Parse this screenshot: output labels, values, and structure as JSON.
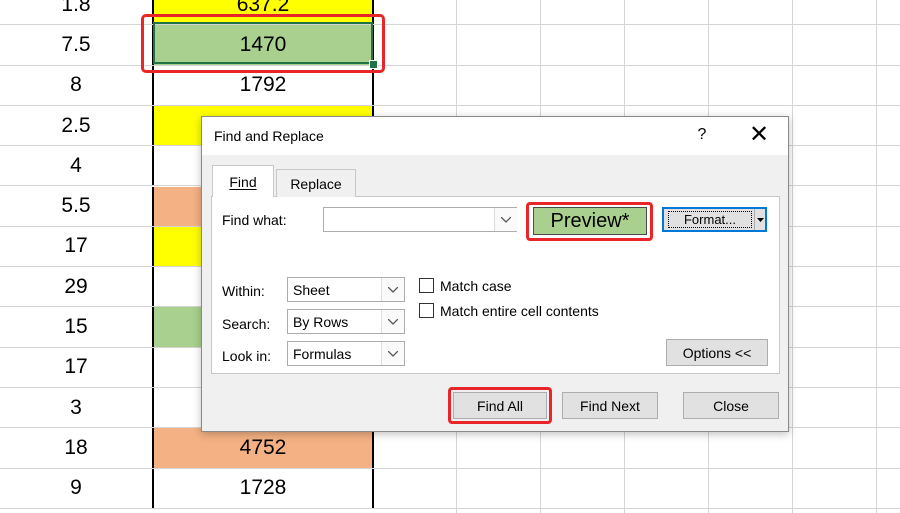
{
  "spreadsheet": {
    "rows": [
      {
        "a": "1.8",
        "b": "637.2",
        "fill": "#ffff00"
      },
      {
        "a": "7.5",
        "b": "1470",
        "fill": "#a9d08e"
      },
      {
        "a": "8",
        "b": "1792",
        "fill": "#ffffff"
      },
      {
        "a": "2.5",
        "b": "",
        "fill": "#ffff00"
      },
      {
        "a": "4",
        "b": "",
        "fill": "#ffffff"
      },
      {
        "a": "5.5",
        "b": "",
        "fill": "#f4b183"
      },
      {
        "a": "17",
        "b": "",
        "fill": "#ffff00"
      },
      {
        "a": "29",
        "b": "",
        "fill": "#ffffff"
      },
      {
        "a": "15",
        "b": "",
        "fill": "#a9d08e"
      },
      {
        "a": "17",
        "b": "",
        "fill": "#ffffff"
      },
      {
        "a": "3",
        "b": "",
        "fill": "#ffffff"
      },
      {
        "a": "18",
        "b": "4752",
        "fill": "#f4b183"
      },
      {
        "a": "9",
        "b": "1728",
        "fill": "#ffffff"
      }
    ]
  },
  "dialog": {
    "title": "Find and Replace",
    "help": "?",
    "close": "✕",
    "tabs": [
      "Find",
      "Replace"
    ],
    "find_what_label": "Find what:",
    "find_what_value": "",
    "preview": "Preview*",
    "format_button": "Format...",
    "within_label": "Within:",
    "within_value": "Sheet",
    "search_label": "Search:",
    "search_value": "By Rows",
    "lookin_label": "Look in:",
    "lookin_value": "Formulas",
    "match_case": "Match case",
    "match_entire": "Match entire cell contents",
    "options_button": "Options <<",
    "find_all": "Find All",
    "find_next": "Find Next",
    "close_button": "Close"
  },
  "colors": {
    "highlight_red": "#e8262a",
    "green_fill": "#a9d08e",
    "yellow_fill": "#ffff00",
    "orange_fill": "#f4b183",
    "focus_blue": "#0078d7"
  }
}
